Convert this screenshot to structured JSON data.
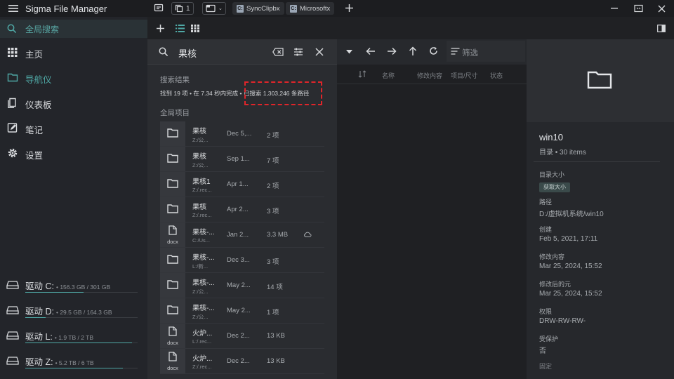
{
  "app": {
    "title": "Sigma File Manager"
  },
  "titlebar": {
    "tab_count": "1",
    "tabs": [
      {
        "label": "SyncClipbx",
        "icon_letter": "C:"
      },
      {
        "label": "Microsoftx",
        "icon_letter": "C:"
      }
    ]
  },
  "sidebar": {
    "search_label": "全局搜索",
    "items": [
      {
        "label": "主页"
      },
      {
        "label": "导航仪"
      },
      {
        "label": "仪表板"
      },
      {
        "label": "笔记"
      },
      {
        "label": "设置"
      }
    ],
    "drives": [
      {
        "name": "驱动 C:",
        "size": "• 156.3 GB / 301 GB",
        "used": 0.52
      },
      {
        "name": "驱动 D:",
        "size": "• 29.5 GB / 164.3 GB",
        "used": 0.18
      },
      {
        "name": "驱动 L:",
        "size": "• 1.9 TB / 2 TB",
        "used": 0.95
      },
      {
        "name": "驱动 Z:",
        "size": "• 5.2 TB / 6 TB",
        "used": 0.87
      }
    ]
  },
  "search": {
    "query": "果核",
    "results_title": "搜索结果",
    "summary_prefix": "找到 19 项 • 在 7.34 秒内完成 • ",
    "summary_highlight": "已搜索 1,303,246 条路径",
    "section_label": "全局项目",
    "results": [
      {
        "type": "folder",
        "ext": "",
        "name": "果核",
        "path": "Z:/公...",
        "date": "Dec 5,...",
        "count": "2 项",
        "cloud": false
      },
      {
        "type": "folder",
        "ext": "",
        "name": "果核",
        "path": "Z:/公...",
        "date": "Sep 1...",
        "count": "7 项",
        "cloud": false
      },
      {
        "type": "folder",
        "ext": "",
        "name": "果核1",
        "path": "Z:/.rec...",
        "date": "Apr 1...",
        "count": "2 项",
        "cloud": false
      },
      {
        "type": "folder",
        "ext": "",
        "name": "果核",
        "path": "Z:/.rec...",
        "date": "Apr 2...",
        "count": "3 项",
        "cloud": false
      },
      {
        "type": "doc",
        "ext": "docx",
        "name": "果核-...",
        "path": "C:/Us...",
        "date": "Jan 2...",
        "count": "3.3 MB",
        "cloud": true
      },
      {
        "type": "folder",
        "ext": "",
        "name": "果核-...",
        "path": "L:/新...",
        "date": "Dec 3...",
        "count": "3 项",
        "cloud": false
      },
      {
        "type": "folder",
        "ext": "",
        "name": "果核-...",
        "path": "Z:/公...",
        "date": "May 2...",
        "count": "14 项",
        "cloud": false
      },
      {
        "type": "folder",
        "ext": "",
        "name": "果核-...",
        "path": "Z:/公...",
        "date": "May 2...",
        "count": "1 项",
        "cloud": false
      },
      {
        "type": "doc",
        "ext": "docx",
        "name": "火炉...",
        "path": "L:/.rec...",
        "date": "Dec 2...",
        "count": "13 KB",
        "cloud": false
      },
      {
        "type": "doc",
        "ext": "docx",
        "name": "火炉...",
        "path": "Z:/.rec...",
        "date": "Dec 2...",
        "count": "13 KB",
        "cloud": false
      }
    ]
  },
  "file_view": {
    "filter_placeholder": "筛选",
    "columns": [
      "名称",
      "修改内容",
      "项目/尺寸",
      "状态"
    ]
  },
  "details": {
    "name": "win10",
    "subtitle": "目录 • 30 items",
    "dir_size_label": "目录大小",
    "get_size_button": "获取大小",
    "path_label": "路径",
    "path_value": "D:/虚拟机系统/win10",
    "created_label": "创建",
    "created_value": "Feb 5, 2021, 17:11",
    "modified_label": "修改内容",
    "modified_value": "Mar 25, 2024, 15:52",
    "meta_modified_label": "修改后的元",
    "meta_modified_value": "Mar 25, 2024, 15:52",
    "permissions_label": "权限",
    "permissions_value": "DRW-RW-RW-",
    "protected_label": "受保护",
    "protected_value": "否",
    "pinned_label": "固定"
  },
  "colors": {
    "accent": "#4fa8a5",
    "highlight_box": "#e0252a"
  }
}
